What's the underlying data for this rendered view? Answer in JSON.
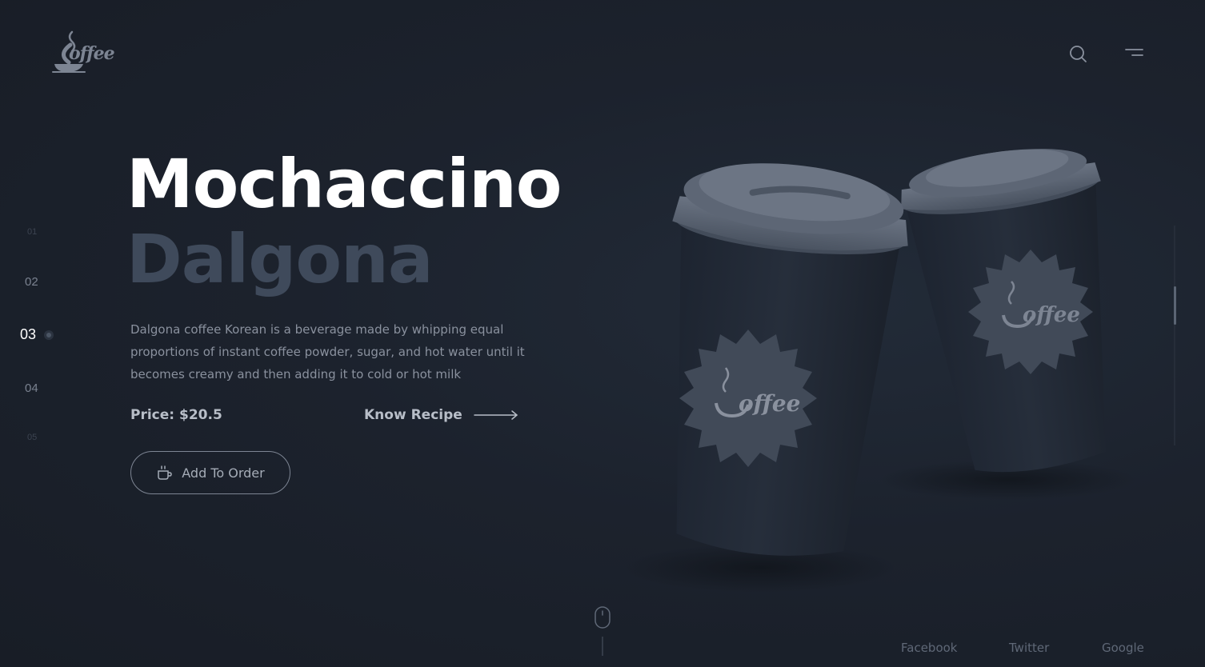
{
  "brand": {
    "logo_text": "offee",
    "accent": "#7d8593"
  },
  "nav": {
    "search_icon": "search-icon",
    "menu_icon": "menu-icon"
  },
  "steps": [
    "01",
    "02",
    "03",
    "04",
    "05"
  ],
  "active_step": "03",
  "hero": {
    "title": "Mochaccino",
    "subtitle": "Dalgona",
    "description": "Dalgona coffee Korean is a beverage made by whipping equal proportions of instant coffee powder, sugar, and hot water until it becomes creamy and then adding it to cold or hot milk",
    "price": "Price: $20.5",
    "recipe_label": "Know Recipe",
    "order_label": "Add To Order"
  },
  "product_image": {
    "cup_logo_text": "offee"
  },
  "socials": {
    "facebook": "Facebook",
    "twitter": "Twitter",
    "google": "Google"
  }
}
